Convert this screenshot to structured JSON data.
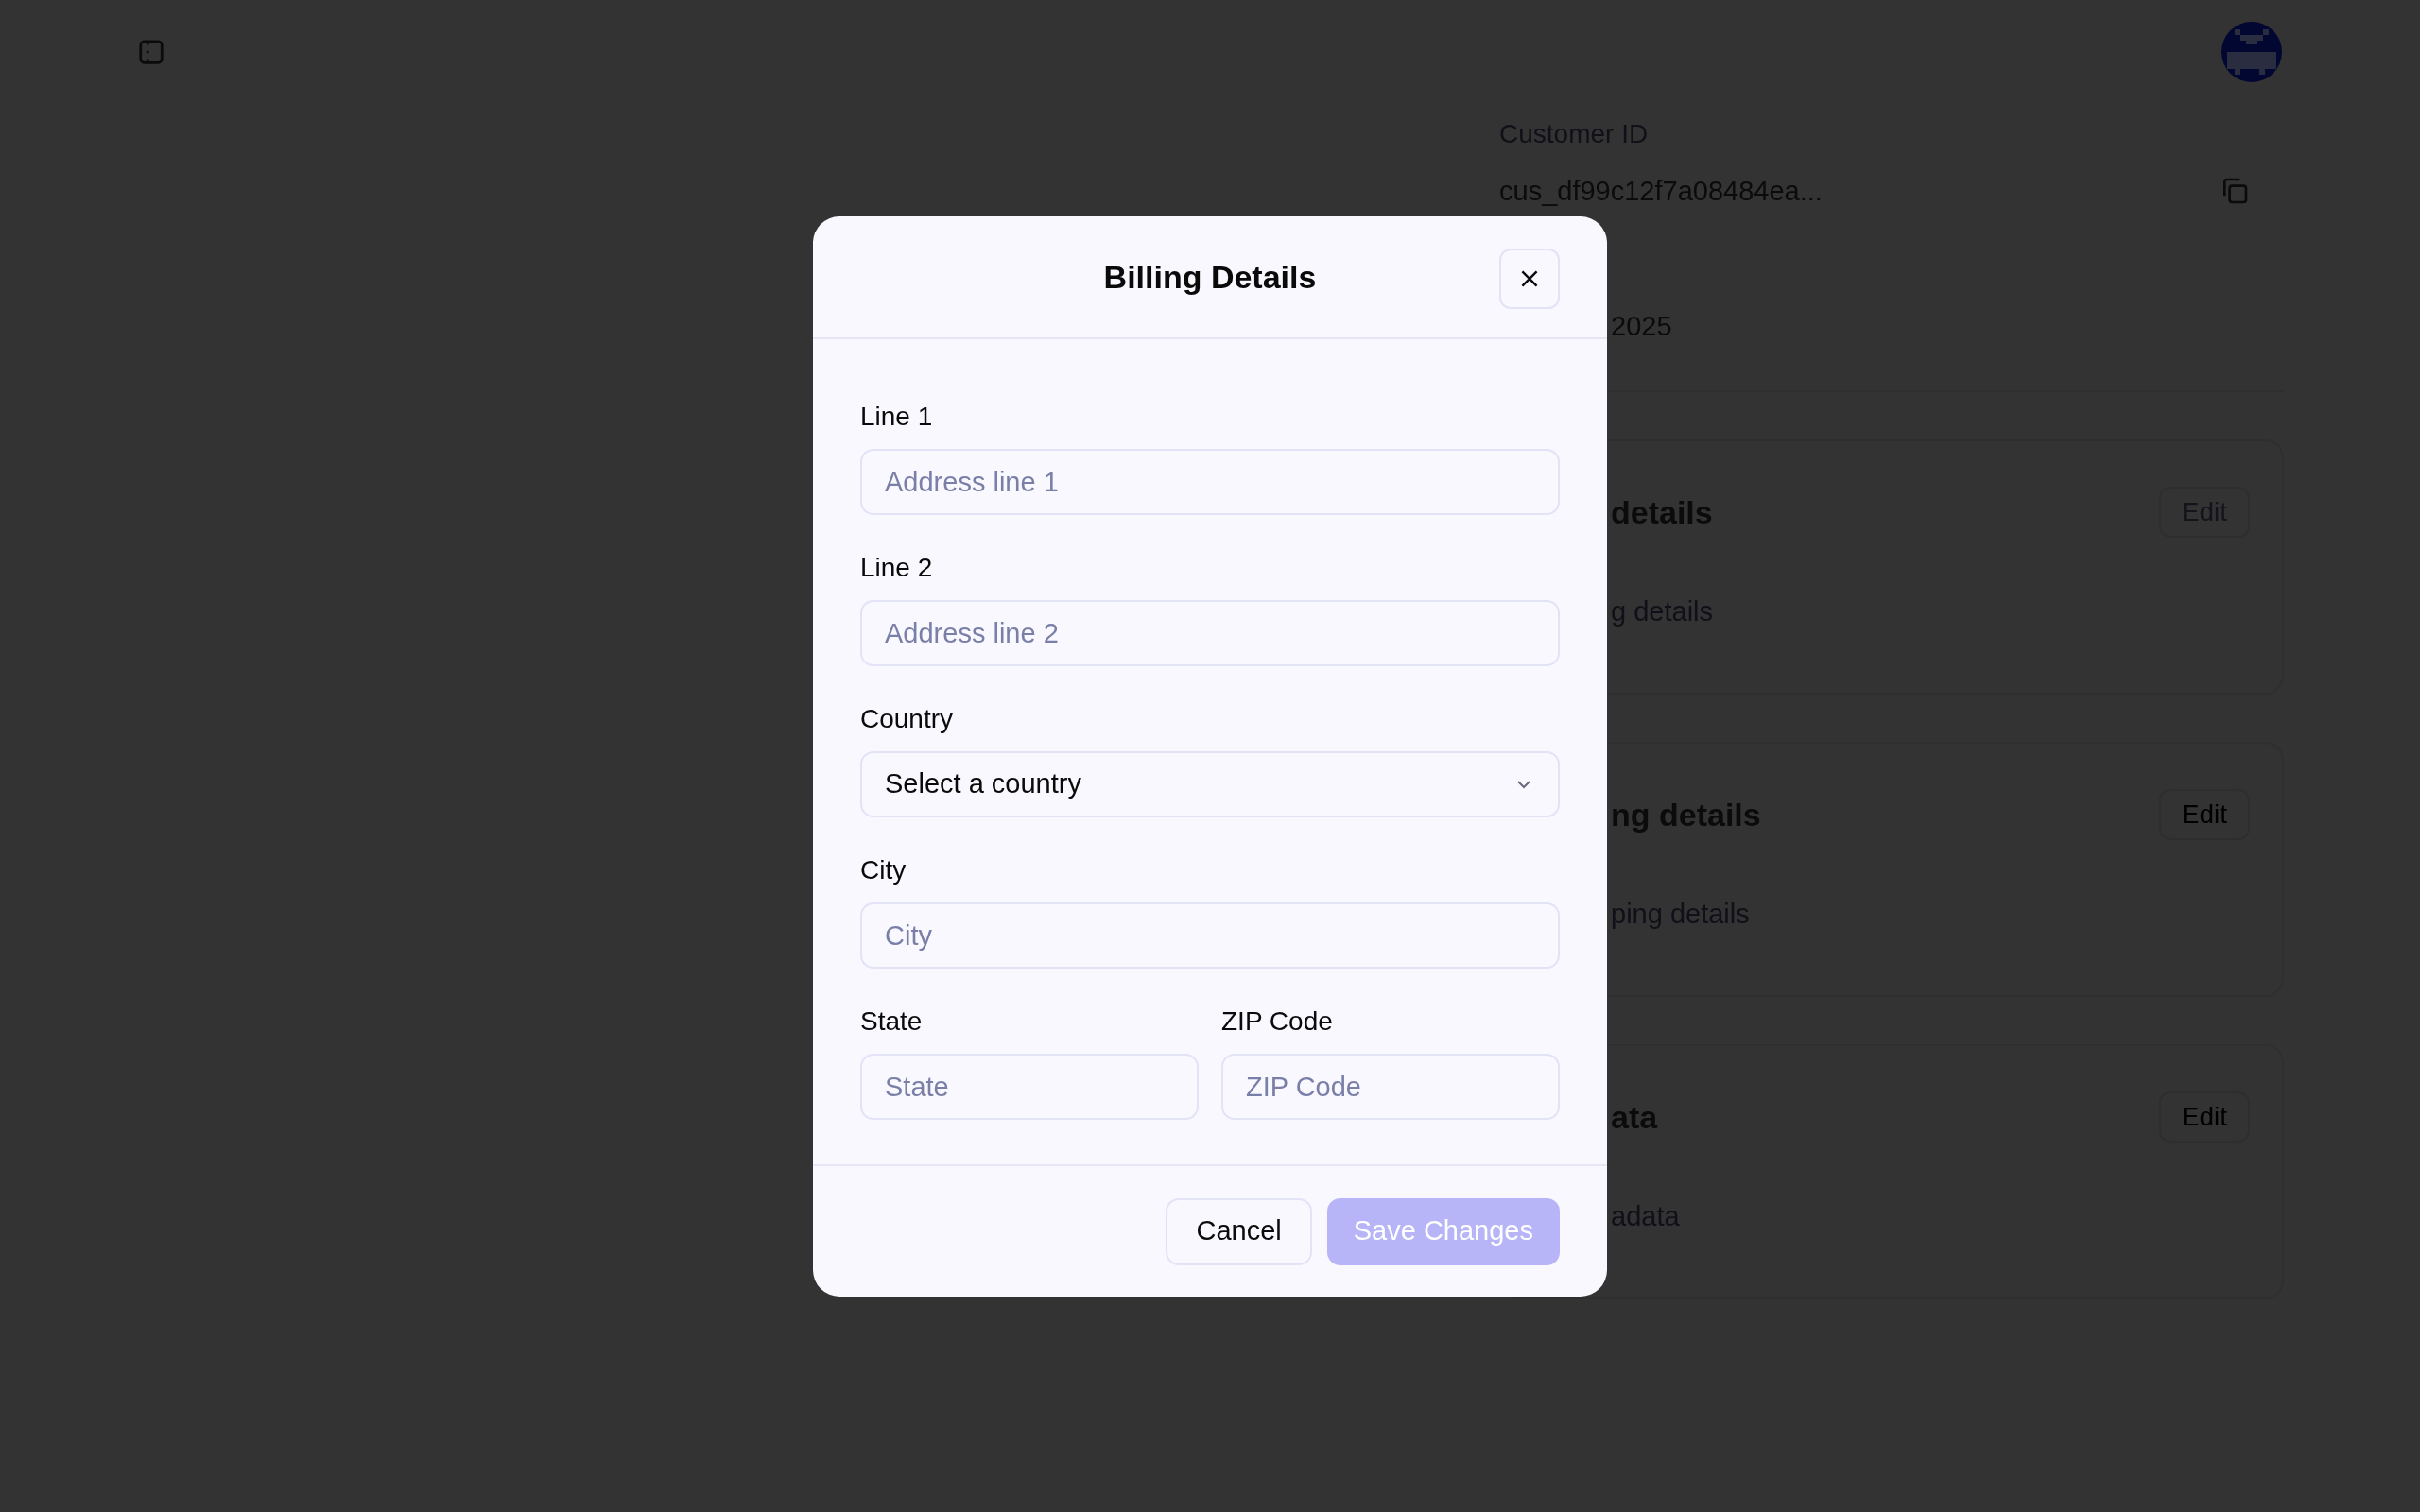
{
  "page": {
    "customer_id_label": "Customer ID",
    "customer_id_value": "cus_df99c12f7a08484ea...",
    "date_fragment": "2025",
    "cards": [
      {
        "title": "details",
        "subtitle": "g details",
        "edit": "Edit",
        "disabled": true
      },
      {
        "title": "ng details",
        "subtitle": "ping details",
        "edit": "Edit",
        "disabled": false
      },
      {
        "title": "ata",
        "subtitle": "adata",
        "edit": "Edit",
        "disabled": false
      }
    ]
  },
  "dialog": {
    "title": "Billing Details",
    "rows": [
      [
        {
          "kind": "input",
          "label": "Line 1",
          "placeholder": "Address line 1"
        }
      ],
      [
        {
          "kind": "input",
          "label": "Line 2",
          "placeholder": "Address line 2"
        }
      ],
      [
        {
          "kind": "select",
          "label": "Country",
          "value": "Select a country"
        }
      ],
      [
        {
          "kind": "input",
          "label": "City",
          "placeholder": "City"
        }
      ],
      [
        {
          "kind": "input",
          "label": "State",
          "placeholder": "State"
        },
        {
          "kind": "input",
          "label": "ZIP Code",
          "placeholder": "ZIP Code"
        }
      ]
    ],
    "buttons": [
      {
        "kind": "secondary",
        "label": "Cancel",
        "disabled": false
      },
      {
        "kind": "primary",
        "label": "Save Changes",
        "disabled": true
      }
    ]
  }
}
